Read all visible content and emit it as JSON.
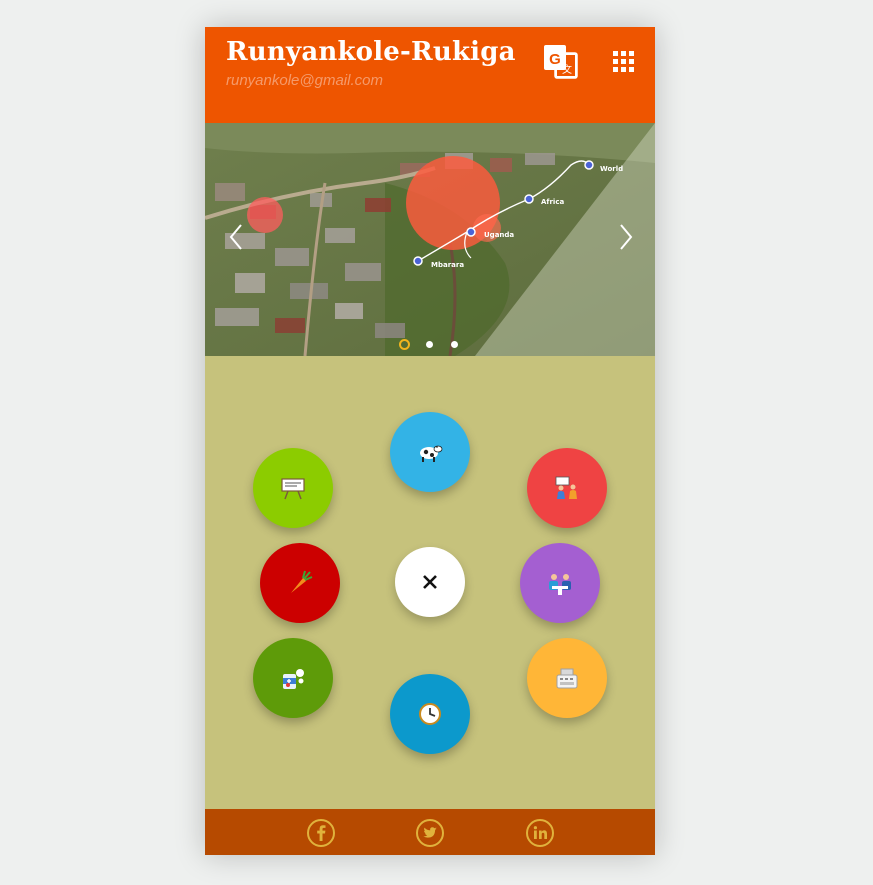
{
  "header": {
    "title": "Runyankole-Rukiga",
    "email": "runyankole@gmail.com",
    "translate_icon": "google-translate-icon",
    "apps_icon": "grid-icon"
  },
  "slider": {
    "labels": [
      "World",
      "Africa",
      "Uganda",
      "Mbarara"
    ],
    "slide_count": 3,
    "active_slide": 1,
    "prev_icon": "chevron-left-icon",
    "next_icon": "chevron-right-icon"
  },
  "menu": {
    "items": [
      {
        "icon": "cow-icon",
        "color": "#33b3e6"
      },
      {
        "icon": "classroom-board-icon",
        "color": "#8ccc00"
      },
      {
        "icon": "teacher-student-icon",
        "color": "#ef4343"
      },
      {
        "icon": "carrot-icon",
        "color": "#cc0000"
      },
      {
        "icon": "meeting-icon",
        "color": "#a45fd1"
      },
      {
        "icon": "medicine-icon",
        "color": "#5e9b09"
      },
      {
        "icon": "clock-icon",
        "color": "#0c99cc"
      },
      {
        "icon": "cash-register-icon",
        "color": "#ffb637"
      }
    ],
    "close_icon": "close-icon"
  },
  "footer": {
    "social": [
      "facebook-icon",
      "twitter-icon",
      "linkedin-icon"
    ]
  },
  "colors": {
    "header": "#ee5500",
    "menu_background": "#c6c27c",
    "footer": "#b64a00",
    "footer_icons": "#e0b23c",
    "active_dot": "#f2b51d"
  }
}
